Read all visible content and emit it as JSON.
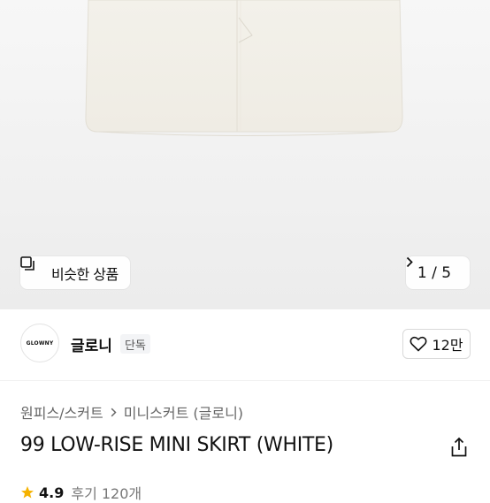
{
  "hero": {
    "similar_label": "비슷한 상품",
    "page_indicator": "1 / 5"
  },
  "seller": {
    "logo_text": "GLOWNY",
    "name": "글로니",
    "badge": "단독",
    "like_count": "12만"
  },
  "breadcrumb": {
    "category": "원피스/스커트",
    "subcategory": "미니스커트 (글로니)"
  },
  "product": {
    "title": "99 LOW-RISE MINI SKIRT (WHITE)"
  },
  "rating": {
    "score": "4.9",
    "reviews": "후기 120개"
  }
}
